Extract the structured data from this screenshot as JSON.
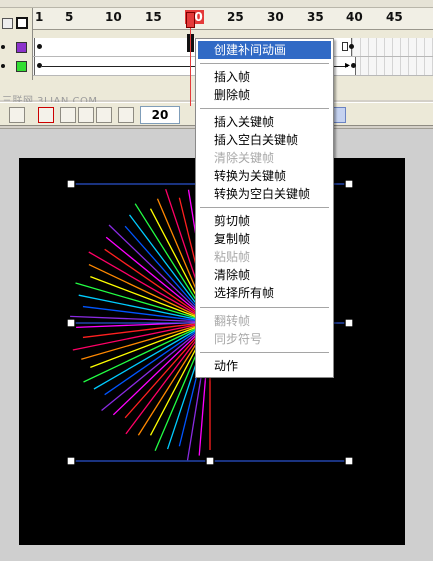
{
  "watermark": "三联网 3LIAN.COM",
  "timeline": {
    "ruler_labels": [
      "1",
      "5",
      "10",
      "15",
      "20",
      "25",
      "30",
      "35",
      "40",
      "45"
    ],
    "frame_number": "20"
  },
  "layers": [
    {
      "color": "#8c33cc"
    },
    {
      "color": "#33dd33"
    }
  ],
  "colors": {
    "menu_highlight": "#316ac5",
    "playhead": "#e43a3a",
    "stage_bg": "#000000",
    "bounding_box": "#3366ff"
  },
  "context_menu": {
    "items": [
      {
        "label": "创建补间动画",
        "enabled": true,
        "active": true
      },
      {
        "label": "插入帧",
        "enabled": true
      },
      {
        "label": "删除帧",
        "enabled": true
      },
      {
        "label": "插入关键帧",
        "enabled": true
      },
      {
        "label": "插入空白关键帧",
        "enabled": true
      },
      {
        "label": "清除关键帧",
        "enabled": false
      },
      {
        "label": "转换为关键帧",
        "enabled": true
      },
      {
        "label": "转换为空白关键帧",
        "enabled": true
      },
      {
        "label": "剪切帧",
        "enabled": true
      },
      {
        "label": "复制帧",
        "enabled": true
      },
      {
        "label": "粘贴帧",
        "enabled": false
      },
      {
        "label": "清除帧",
        "enabled": true
      },
      {
        "label": "选择所有帧",
        "enabled": true
      },
      {
        "label": "翻转帧",
        "enabled": false
      },
      {
        "label": "同步符号",
        "enabled": false
      },
      {
        "label": "动作",
        "enabled": true
      }
    ]
  }
}
